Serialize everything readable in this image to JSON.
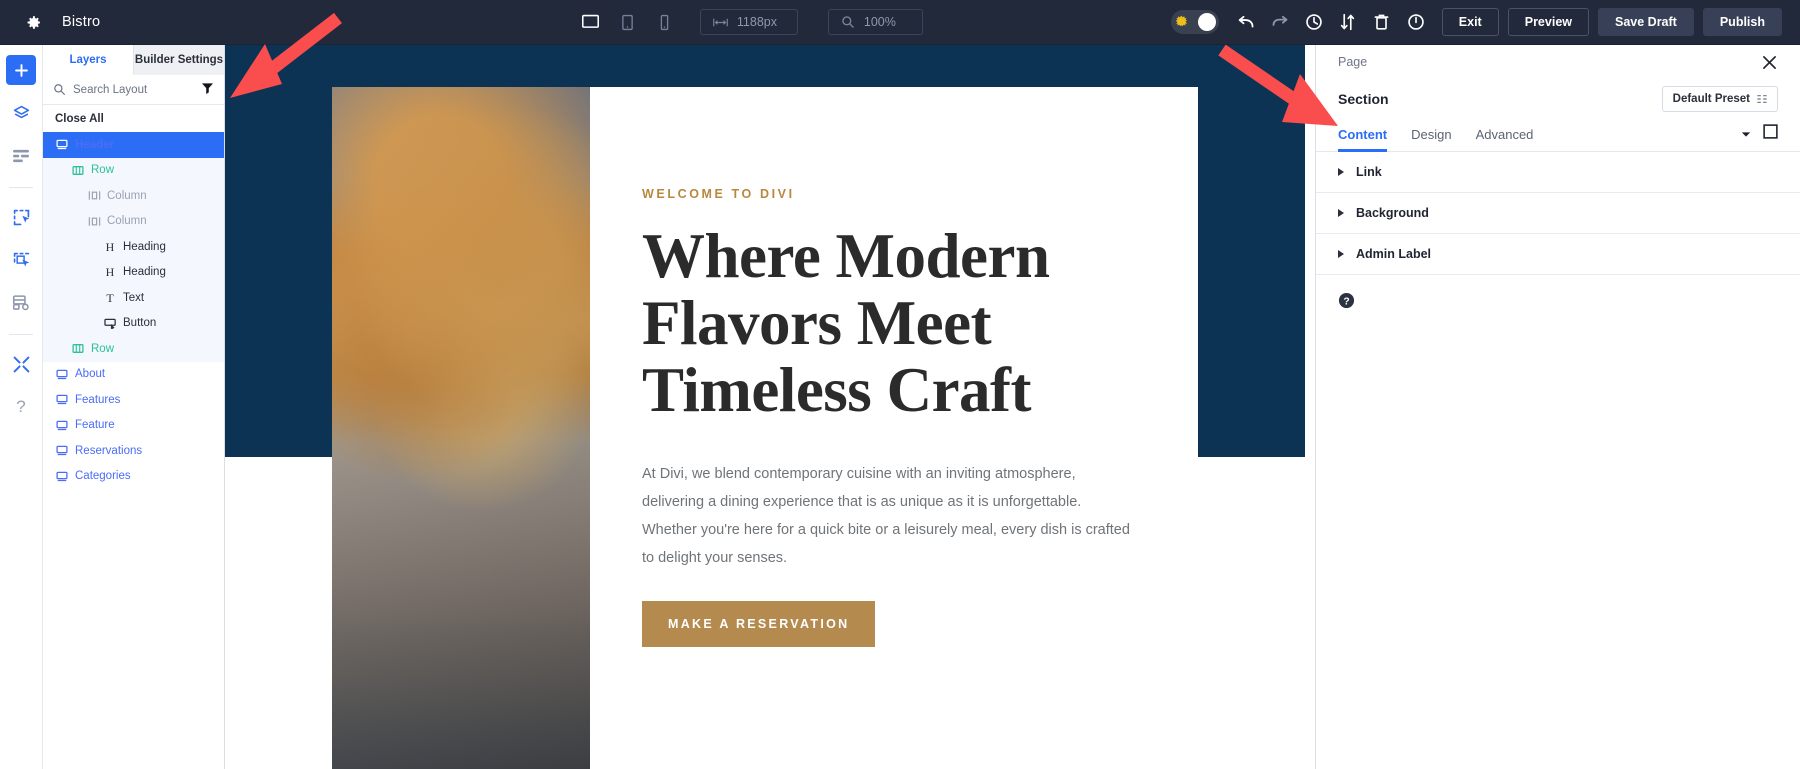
{
  "topbar": {
    "gear_icon": "gear-icon",
    "site_title": "Bistro",
    "devices": [
      {
        "name": "desktop-view",
        "icon": "desktop-icon",
        "active": true
      },
      {
        "name": "tablet-view",
        "icon": "tablet-icon",
        "active": false
      },
      {
        "name": "phone-view",
        "icon": "phone-icon",
        "active": false
      }
    ],
    "width_value": "1188px",
    "zoom_value": "100%",
    "tools": [
      {
        "name": "undo-button",
        "icon": "undo-icon"
      },
      {
        "name": "redo-button",
        "icon": "redo-icon"
      },
      {
        "name": "history-button",
        "icon": "clock-icon"
      },
      {
        "name": "portability-button",
        "icon": "up-down-arrows-icon"
      },
      {
        "name": "trash-button",
        "icon": "trash-icon"
      },
      {
        "name": "power-button",
        "icon": "power-icon"
      }
    ],
    "exit_label": "Exit",
    "preview_label": "Preview",
    "save_draft_label": "Save Draft",
    "publish_label": "Publish"
  },
  "rail": {
    "items": [
      {
        "name": "add-item",
        "icon": "plus-icon",
        "primary": true
      },
      {
        "name": "layers-item",
        "icon": "layers-icon",
        "primary": false
      },
      {
        "name": "wireframe-item",
        "icon": "wireframe-icon",
        "primary": false
      },
      {
        "name": "select-item",
        "icon": "select-module-icon",
        "primary": false
      },
      {
        "name": "multiselect-item",
        "icon": "multiselect-module-icon",
        "primary": false
      },
      {
        "name": "preview-item",
        "icon": "page-preview-icon",
        "primary": false
      },
      {
        "name": "tools-item",
        "icon": "tools-icon",
        "primary": false
      },
      {
        "name": "help-item",
        "icon": "question-mark-icon",
        "primary": false
      }
    ]
  },
  "layers_panel": {
    "tabs": [
      {
        "label": "Layers",
        "active": true
      },
      {
        "label": "Builder Settings",
        "active": false
      }
    ],
    "search_placeholder": "Search Layout",
    "search_icon": "search-icon",
    "filter_icon": "filter-icon",
    "close_all_label": "Close All",
    "items": [
      {
        "label": "Header",
        "type": "section",
        "indent": 1,
        "selected": true,
        "icon": "section-icon",
        "shaded": false
      },
      {
        "label": "Row",
        "type": "row",
        "indent": 2,
        "selected": false,
        "icon": "row-icon",
        "shaded": true
      },
      {
        "label": "Column",
        "type": "column",
        "indent": 3,
        "selected": false,
        "icon": "column-icon",
        "shaded": true
      },
      {
        "label": "Column",
        "type": "column",
        "indent": 3,
        "selected": false,
        "icon": "column-icon",
        "shaded": true
      },
      {
        "label": "Heading",
        "type": "module",
        "indent": 4,
        "selected": false,
        "icon": "heading-icon",
        "shaded": true
      },
      {
        "label": "Heading",
        "type": "module",
        "indent": 4,
        "selected": false,
        "icon": "heading-icon",
        "shaded": true
      },
      {
        "label": "Text",
        "type": "module",
        "indent": 4,
        "selected": false,
        "icon": "text-icon",
        "shaded": true
      },
      {
        "label": "Button",
        "type": "module",
        "indent": 4,
        "selected": false,
        "icon": "button-icon",
        "shaded": true
      },
      {
        "label": "Row",
        "type": "row",
        "indent": 2,
        "selected": false,
        "icon": "row-icon",
        "shaded": true
      },
      {
        "label": "About",
        "type": "section",
        "indent": 1,
        "selected": false,
        "icon": "section-icon",
        "shaded": false
      },
      {
        "label": "Features",
        "type": "section",
        "indent": 1,
        "selected": false,
        "icon": "section-icon",
        "shaded": false
      },
      {
        "label": "Feature",
        "type": "section",
        "indent": 1,
        "selected": false,
        "icon": "section-icon",
        "shaded": false
      },
      {
        "label": "Reservations",
        "type": "section",
        "indent": 1,
        "selected": false,
        "icon": "section-icon",
        "shaded": false
      },
      {
        "label": "Categories",
        "type": "section",
        "indent": 1,
        "selected": false,
        "icon": "section-icon",
        "shaded": false
      }
    ]
  },
  "canvas": {
    "eyebrow": "WELCOME TO DIVI",
    "heading_line1": "Where Modern",
    "heading_line2": "Flavors Meet",
    "heading_line3": "Timeless Craft",
    "paragraph": "At Divi, we blend contemporary cuisine with an inviting atmosphere, delivering a dining experience that is as unique as it is unforgettable. Whether you're here for a quick bite or a leisurely meal, every dish is crafted to delight your senses.",
    "cta_label": "MAKE A RESERVATION",
    "hero_bg_color": "#0c3354",
    "cta_color": "#b58a4e",
    "eyebrow_color": "#b8883f"
  },
  "right_panel": {
    "breadcrumb": "Page",
    "close_icon": "close-icon",
    "title": "Section",
    "preset_label": "Default Preset",
    "preset_icon": "preset-icon",
    "tabs": [
      {
        "label": "Content",
        "active": true
      },
      {
        "label": "Design",
        "active": false
      },
      {
        "label": "Advanced",
        "active": false
      }
    ],
    "tab_caret_icon": "chevron-down-icon",
    "tab_expand_icon": "expand-square-icon",
    "accordions": [
      {
        "label": "Link"
      },
      {
        "label": "Background"
      },
      {
        "label": "Admin Label"
      }
    ],
    "help_icon": "help-circle-icon"
  },
  "annotations": {
    "arrow_color": "#fa4d4d",
    "arrows": [
      {
        "name": "arrow-to-layers-panel"
      },
      {
        "name": "arrow-to-settings-panel"
      }
    ]
  }
}
